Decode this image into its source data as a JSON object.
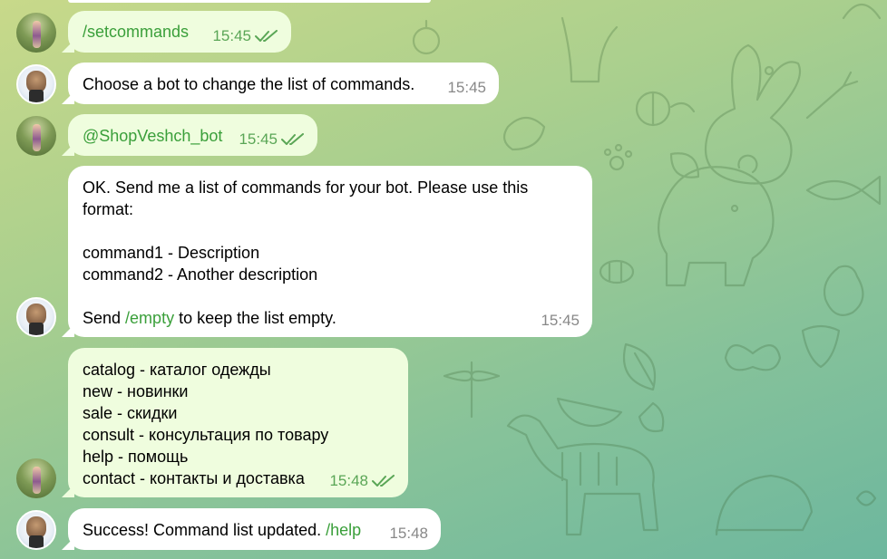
{
  "colors": {
    "outgoing_bubble": "#effdde",
    "incoming_bubble": "#ffffff",
    "command_link": "#3a9f3a",
    "read_checks": "#5aa656",
    "time_incoming": "#888888"
  },
  "messages": [
    {
      "sender": "user",
      "text": "/setcommands",
      "time": "15:45",
      "status_icon": "double-check-icon"
    },
    {
      "sender": "bot",
      "text": "Choose a bot to change the list of commands.",
      "time": "15:45"
    },
    {
      "sender": "user",
      "text": "@ShopVeshch_bot",
      "time": "15:45",
      "status_icon": "double-check-icon"
    },
    {
      "sender": "bot",
      "lines": [
        "OK. Send me a list of commands for your bot. Please use this",
        "format:",
        "",
        "command1 - Description",
        "command2 - Another description",
        ""
      ],
      "last_line_pre": "Send ",
      "last_line_link": "/empty",
      "last_line_post": " to keep the list empty.",
      "time": "15:45"
    },
    {
      "sender": "user",
      "lines": [
        "catalog - каталог одежды",
        "new - новинки",
        "sale - скидки",
        "consult - консультация по товару",
        "help - помощь",
        "contact - контакты и доставка"
      ],
      "time": "15:48",
      "status_icon": "double-check-icon"
    },
    {
      "sender": "bot",
      "text_pre": "Success! Command list updated. ",
      "text_link": "/help",
      "time": "15:48"
    }
  ]
}
